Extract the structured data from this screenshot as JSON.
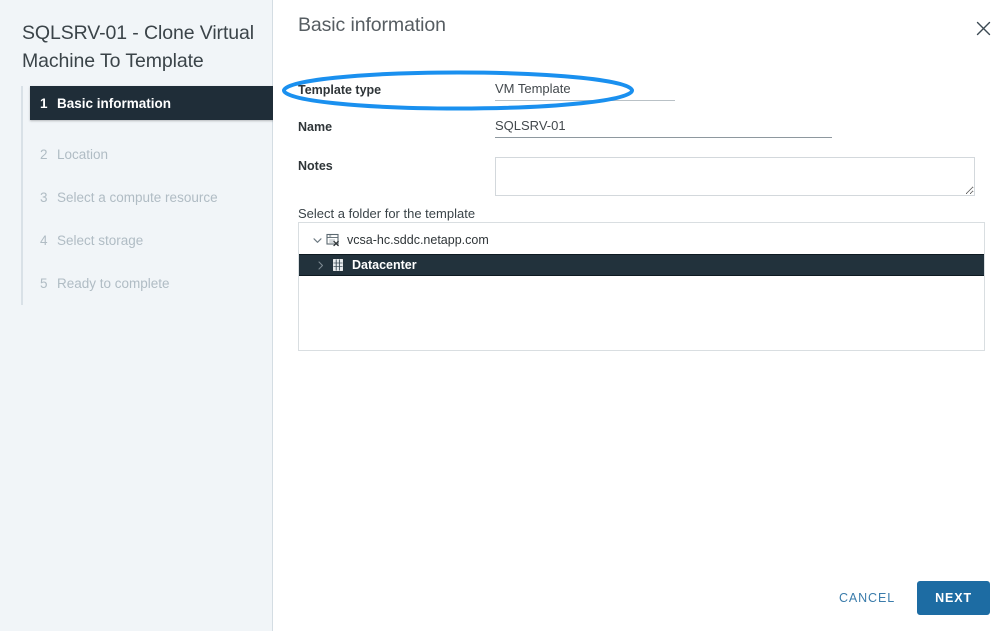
{
  "wizard": {
    "title": "SQLSRV-01 - Clone Virtual Machine To Template",
    "steps": [
      {
        "num": "1",
        "label": "Basic information",
        "state": "active"
      },
      {
        "num": "2",
        "label": "Location",
        "state": "pending"
      },
      {
        "num": "3",
        "label": "Select a compute resource",
        "state": "pending"
      },
      {
        "num": "4",
        "label": "Select storage",
        "state": "pending"
      },
      {
        "num": "5",
        "label": "Ready to complete",
        "state": "pending"
      }
    ]
  },
  "page": {
    "title": "Basic information",
    "close_icon": "close-icon"
  },
  "form": {
    "template_type": {
      "label": "Template type",
      "value": "VM Template"
    },
    "name": {
      "label": "Name",
      "value": "SQLSRV-01",
      "placeholder": ""
    },
    "notes": {
      "label": "Notes",
      "value": "",
      "placeholder": ""
    }
  },
  "tree": {
    "caption": "Select a folder for the template",
    "nodes": [
      {
        "label": "vcsa-hc.sddc.netapp.com",
        "icon": "vcenter-server-icon",
        "twisty": "chevron-down-icon",
        "expanded": true,
        "selected": false
      },
      {
        "label": "Datacenter",
        "icon": "datacenter-icon",
        "twisty": "chevron-right-icon",
        "expanded": false,
        "selected": true
      }
    ]
  },
  "footer": {
    "cancel_label": "CANCEL",
    "next_label": "NEXT"
  },
  "annotation": {
    "type": "ellipse-highlight",
    "color": "#1a90ef",
    "target": "Template type"
  },
  "colors": {
    "accent": "#1d6ca3",
    "link": "#3b7cab",
    "sidebar_bg": "#f1f5f8",
    "active_step_bg": "#1f2d38",
    "selected_row_bg": "#22323c",
    "highlight": "#1a90ef"
  }
}
